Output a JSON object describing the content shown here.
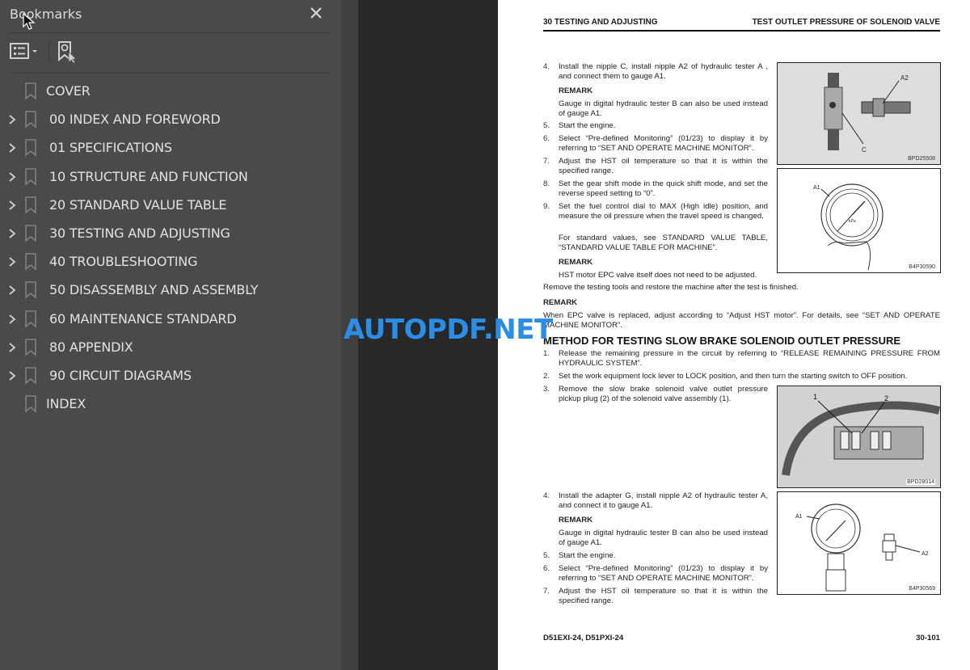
{
  "bookmarks_panel": {
    "title": "Bookmarks",
    "close_icon": "close-icon",
    "toolbar": {
      "options_icon": "list-options-icon",
      "find_icon": "find-current-bookmark-icon"
    },
    "items": [
      {
        "label": "COVER",
        "expandable": false
      },
      {
        "label": "00 INDEX AND FOREWORD",
        "expandable": true
      },
      {
        "label": "01 SPECIFICATIONS",
        "expandable": true
      },
      {
        "label": "10 STRUCTURE AND FUNCTION",
        "expandable": true
      },
      {
        "label": "20 STANDARD VALUE TABLE",
        "expandable": true
      },
      {
        "label": "30 TESTING AND ADJUSTING",
        "expandable": true
      },
      {
        "label": "40 TROUBLESHOOTING",
        "expandable": true
      },
      {
        "label": "50 DISASSEMBLY AND ASSEMBLY",
        "expandable": true
      },
      {
        "label": "60 MAINTENANCE STANDARD",
        "expandable": true
      },
      {
        "label": "80 APPENDIX",
        "expandable": true
      },
      {
        "label": "90 CIRCUIT DIAGRAMS",
        "expandable": true
      },
      {
        "label": "INDEX",
        "expandable": false
      }
    ]
  },
  "watermark": "AUTOPDF.NET",
  "page": {
    "header_left": "30 TESTING AND ADJUSTING",
    "header_right": "TEST OUTLET PRESSURE OF SOLENOID VALVE",
    "section1": {
      "steps": [
        {
          "num": "4.",
          "text": "Install the nipple C, install nipple A2 of hydraulic tester A , and connect them to gauge A1."
        },
        {
          "num": "5.",
          "text": "Start the engine."
        },
        {
          "num": "6.",
          "text": "Select “Pre-defined Monitoring” (01/23) to display it by referring to “SET AND OPERATE MACHINE MONITOR”."
        },
        {
          "num": "7.",
          "text": "Adjust the HST oil temperature so that it is within the specified range."
        },
        {
          "num": "8.",
          "text": "Set the gear shift mode in the quick shift mode, and set the reverse speed setting to “0”."
        },
        {
          "num": "9.",
          "text": "Set the fuel control dial to MAX (High idle) position, and measure the oil pressure when the travel speed is changed."
        }
      ],
      "remark_label": "REMARK",
      "remark1": "Gauge in digital hydraulic tester B can also be used instead of gauge A1.",
      "standard_values": "For standard values, see STANDARD VALUE TABLE, “STANDARD VALUE TABLE FOR MACHINE”.",
      "remark2": "HST motor EPC valve itself does not need to be adjusted.",
      "restore": "Remove the testing tools and restore the machine after the test is finished.",
      "remark3": "When EPC valve is replaced, adjust according to “Adjust HST motor”. For details, see “SET AND OPERATE MACHINE MONITOR”."
    },
    "section2": {
      "title": "METHOD FOR TESTING SLOW BRAKE SOLENOID OUTLET PRESSURE",
      "steps": [
        {
          "num": "1.",
          "text": "Release the remaining pressure in the circuit by referring to “RELEASE REMAINING PRESSURE FROM HYDRAULIC SYSTEM”."
        },
        {
          "num": "2.",
          "text": "Set the work equipment lock lever to LOCK position, and then turn the starting switch to OFF position."
        },
        {
          "num": "3.",
          "text": "Remove the slow brake solenoid valve outlet pressure pickup plug (2) of the solenoid valve assembly (1)."
        },
        {
          "num": "4.",
          "text": "Install the adapter G, install nipple A2 of hydraulic tester A, and connect it to gauge A1."
        },
        {
          "num": "5.",
          "text": "Start the engine."
        },
        {
          "num": "6.",
          "text": "Select “Pre-defined Monitoring” (01/23) to display it by referring to “SET AND OPERATE MACHINE MONITOR”."
        },
        {
          "num": "7.",
          "text": "Adjust the HST oil temperature so that it is within the specified range."
        }
      ],
      "remark_label": "REMARK",
      "remark": "Gauge in digital hydraulic tester B can also be used instead of gauge A1."
    },
    "figures": [
      {
        "code": "BPD25508",
        "labels": [
          "A2",
          "C"
        ]
      },
      {
        "code": "B4P30590",
        "labels": [
          "A1",
          "kPa"
        ]
      },
      {
        "code": "BPD28014",
        "labels": [
          "1",
          "2"
        ]
      },
      {
        "code": "B4P30569",
        "labels": [
          "A1",
          "A2"
        ]
      }
    ],
    "footer_left": "D51EXI-24, D51PXI-24",
    "footer_right": "30-101"
  }
}
